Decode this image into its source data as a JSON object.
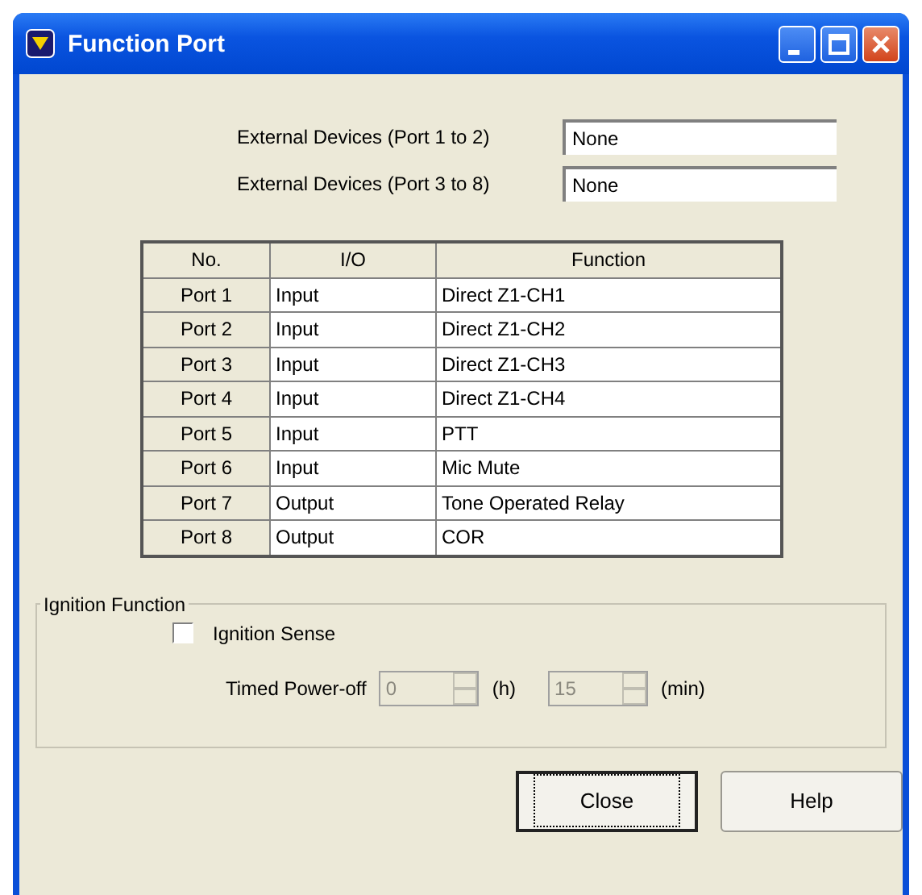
{
  "window": {
    "title": "Function Port"
  },
  "devices": [
    {
      "label": "External Devices (Port 1 to 2)",
      "value": "None"
    },
    {
      "label": "External Devices (Port 3 to 8)",
      "value": "None"
    }
  ],
  "table": {
    "columns": [
      "No.",
      "I/O",
      "Function"
    ],
    "rows": [
      [
        "Port 1",
        "Input",
        "Direct Z1-CH1"
      ],
      [
        "Port 2",
        "Input",
        "Direct Z1-CH2"
      ],
      [
        "Port 3",
        "Input",
        "Direct Z1-CH3"
      ],
      [
        "Port 4",
        "Input",
        "Direct Z1-CH4"
      ],
      [
        "Port 5",
        "Input",
        "PTT"
      ],
      [
        "Port 6",
        "Input",
        "Mic Mute"
      ],
      [
        "Port 7",
        "Output",
        "Tone Operated Relay"
      ],
      [
        "Port 8",
        "Output",
        "COR"
      ]
    ]
  },
  "ignition": {
    "title": "Ignition Function",
    "sense": {
      "label": "Ignition Sense",
      "checked": false
    },
    "timed_label": "Timed Power-off",
    "spinners": [
      {
        "value": "0",
        "unit": "(h)",
        "disabled": true
      },
      {
        "value": "15",
        "unit": "(min)",
        "disabled": true
      }
    ]
  },
  "buttons": [
    {
      "label": "Close",
      "selected": true
    },
    {
      "label": "Help",
      "selected": false
    }
  ]
}
